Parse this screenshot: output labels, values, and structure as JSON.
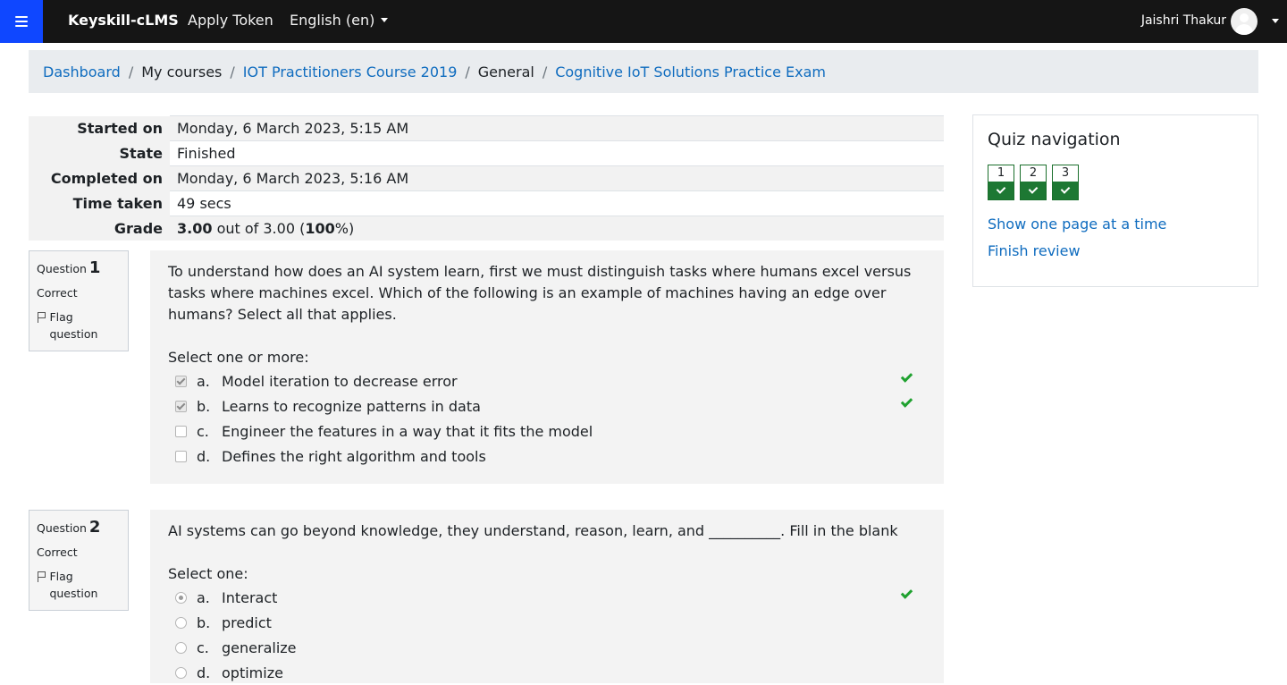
{
  "navbar": {
    "brand": "Keyskill-cLMS",
    "apply_token": "Apply Token",
    "language": "English (en)",
    "user_name": "Jaishri Thakur",
    "bg_color": "#151515",
    "toggle_color": "#0f47ff"
  },
  "breadcrumb": {
    "items": [
      {
        "label": "Dashboard",
        "link": true
      },
      {
        "label": "My courses",
        "link": false
      },
      {
        "label": "IOT Practitioners Course 2019",
        "link": true
      },
      {
        "label": "General",
        "link": false
      },
      {
        "label": "Cognitive IoT Solutions Practice Exam",
        "link": true
      }
    ],
    "separator": "/"
  },
  "summary": {
    "rows": [
      {
        "label": "Started on",
        "value": "Monday, 6 March 2023, 5:15 AM"
      },
      {
        "label": "State",
        "value": "Finished"
      },
      {
        "label": "Completed on",
        "value": "Monday, 6 March 2023, 5:16 AM"
      },
      {
        "label": "Time taken",
        "value": "49 secs"
      }
    ],
    "grade": {
      "label": "Grade",
      "score": "3.00",
      "out_of": " out of 3.00 (",
      "percent": "100",
      "suffix": "%)"
    }
  },
  "questions": [
    {
      "label": "Question",
      "number": "1",
      "state": "Correct",
      "flag_label": "Flag question",
      "text": "To understand how does an AI system learn, first we must distinguish tasks where humans excel versus tasks where machines excel. Which of the following is an example of machines having an edge over humans? Select all that applies.",
      "prompt": "Select one or more:",
      "options": [
        {
          "letter": "a.",
          "text": "Model iteration to decrease error",
          "selected": true,
          "correct": true
        },
        {
          "letter": "b.",
          "text": "Learns to recognize patterns in data",
          "selected": true,
          "correct": true
        },
        {
          "letter": "c.",
          "text": "Engineer the features in a way that it fits the model",
          "selected": false,
          "correct": false
        },
        {
          "letter": "d.",
          "text": "Defines the right algorithm and tools",
          "selected": false,
          "correct": false
        }
      ]
    },
    {
      "label": "Question",
      "number": "2",
      "state": "Correct",
      "flag_label": "Flag question",
      "text": "AI systems can go beyond knowledge, they understand, reason, learn, and __________. Fill in the blank",
      "prompt": "Select one:",
      "options": [
        {
          "letter": "a.",
          "text": "Interact",
          "selected": true,
          "correct": true
        },
        {
          "letter": "b.",
          "text": "predict",
          "selected": false,
          "correct": false
        },
        {
          "letter": "c.",
          "text": "generalize",
          "selected": false,
          "correct": false
        },
        {
          "letter": "d.",
          "text": "optimize",
          "selected": false,
          "correct": false
        }
      ]
    }
  ],
  "quiz_nav": {
    "title": "Quiz navigation",
    "buttons": [
      "1",
      "2",
      "3"
    ],
    "show_one_page": "Show one page at a time",
    "finish_review": "Finish review",
    "correct_color": "#1d7833"
  },
  "colors": {
    "link": "#0f6cbf",
    "tick": "#1fa12f",
    "breadcrumb_bg": "#e9ecef"
  }
}
